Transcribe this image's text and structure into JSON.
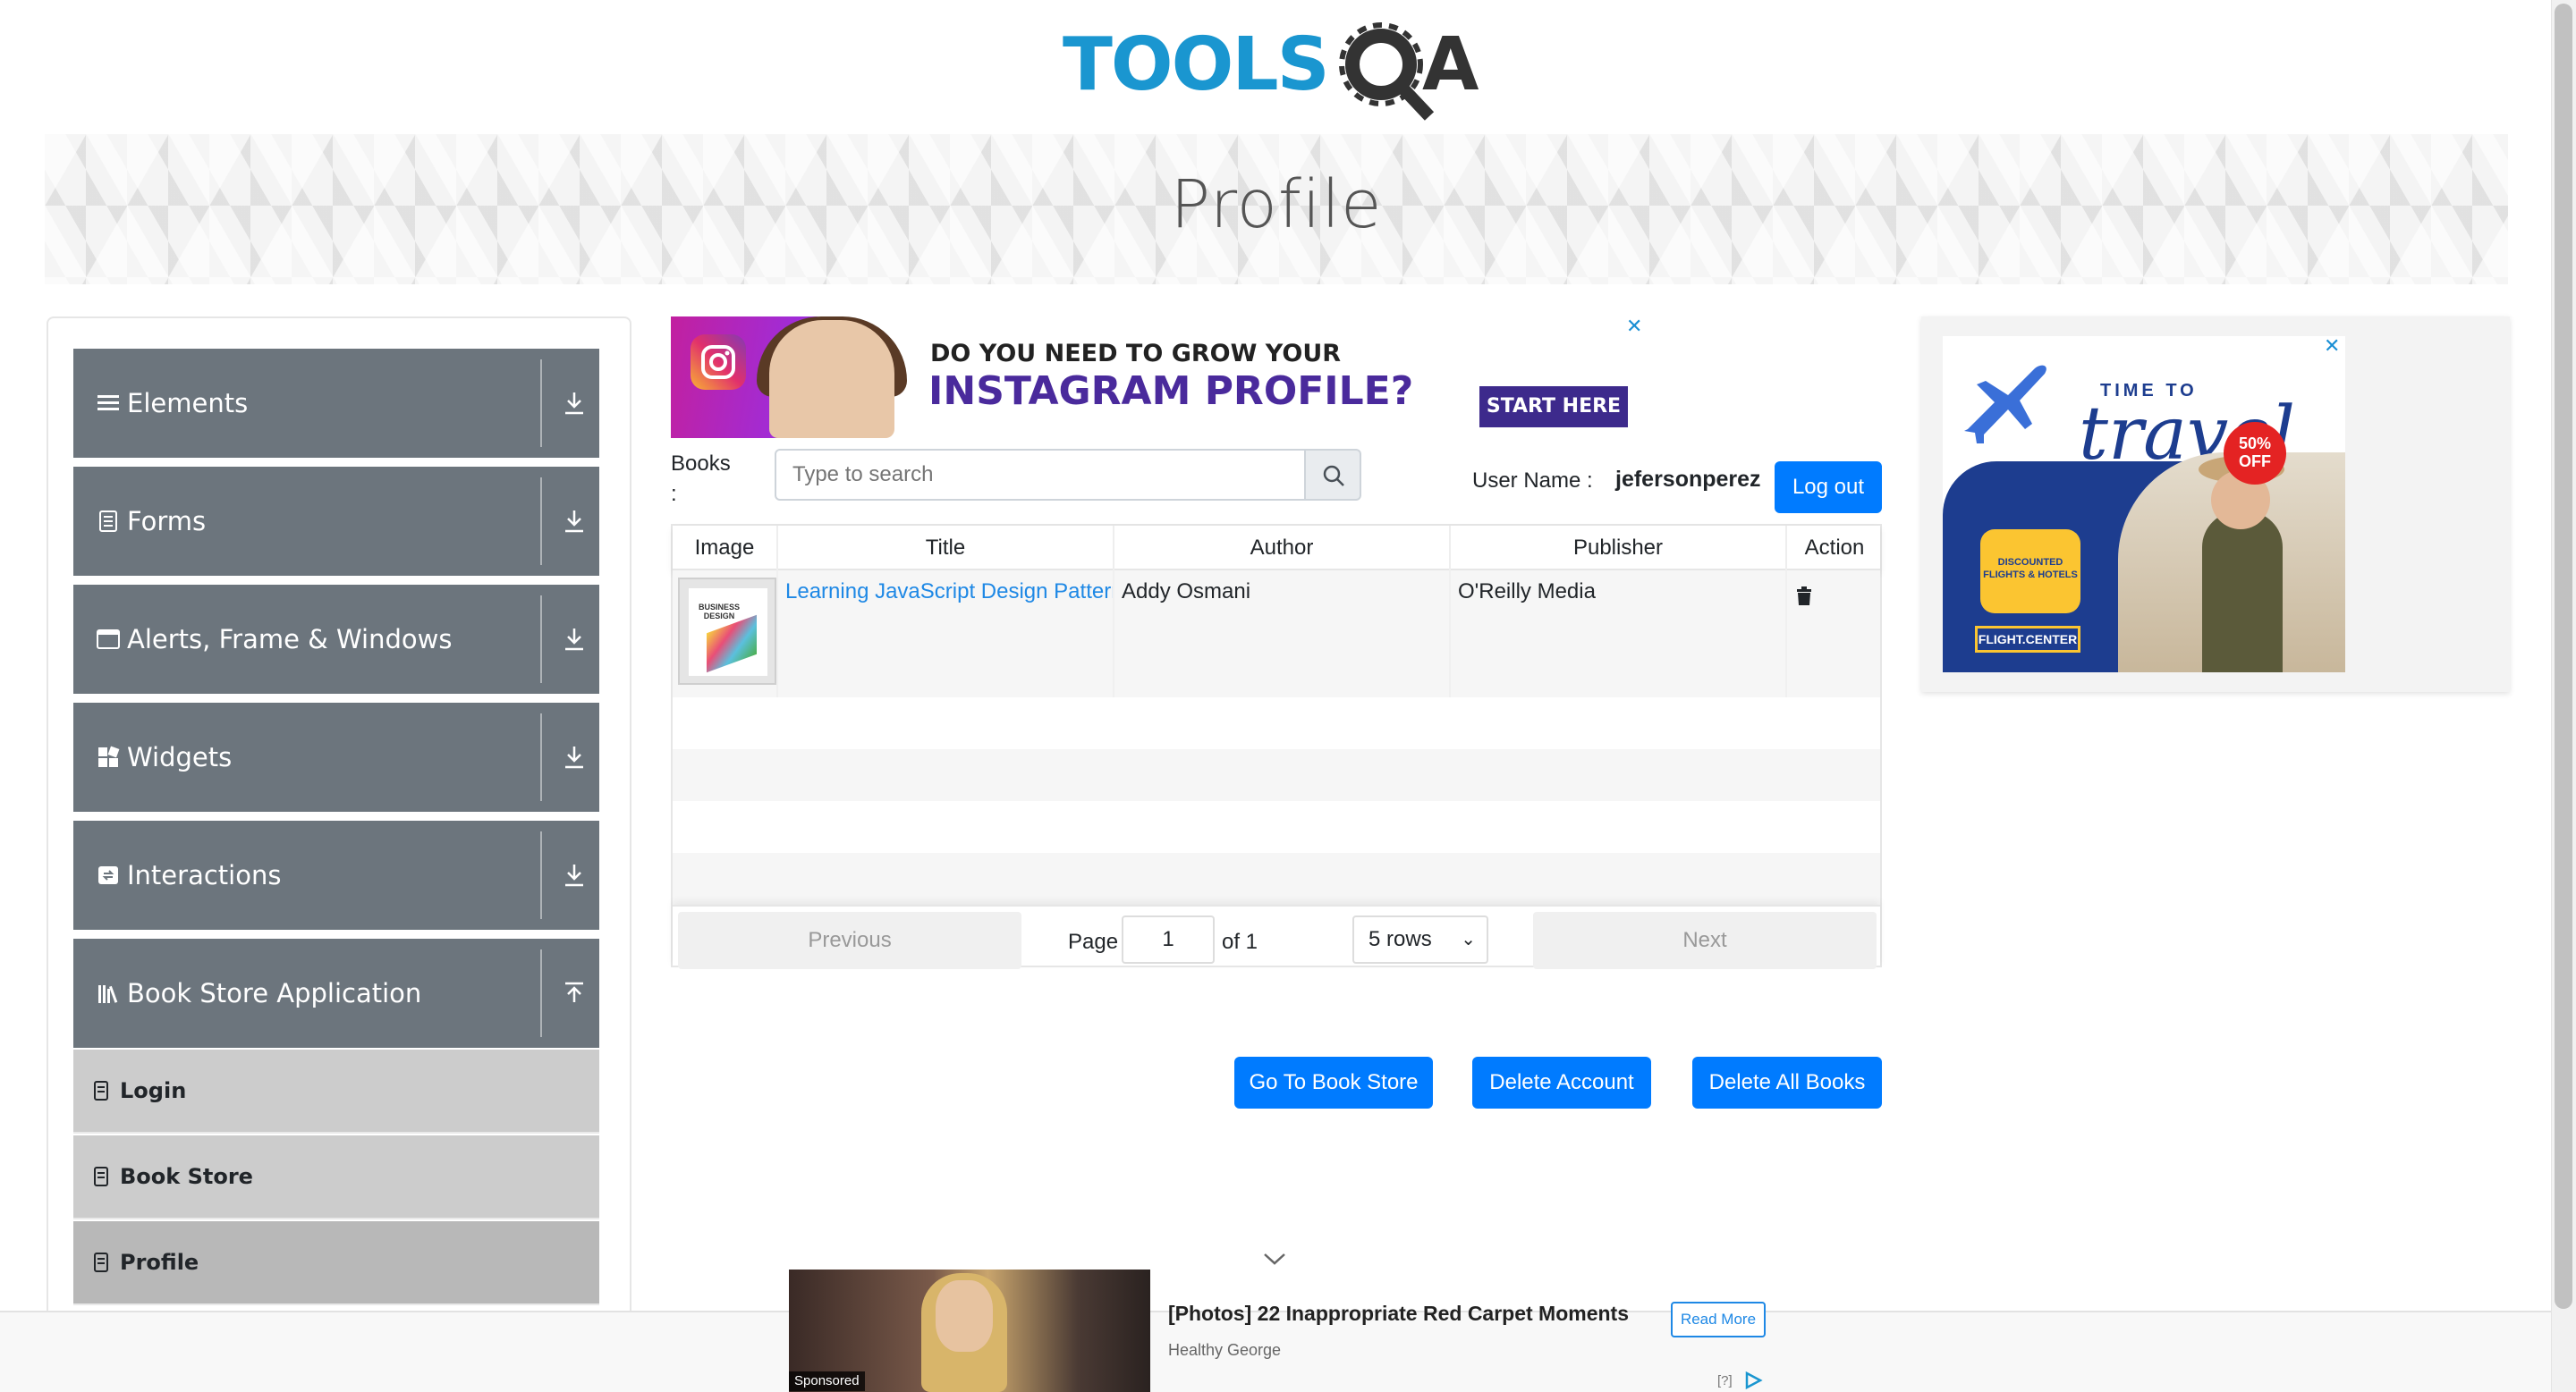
{
  "brand": {
    "logo_text": "TOOLSQA"
  },
  "banner": {
    "title": "Profile"
  },
  "sidebar": {
    "groups": [
      {
        "label": "Elements",
        "icon": "hamburger-icon"
      },
      {
        "label": "Forms",
        "icon": "form-icon"
      },
      {
        "label": "Alerts, Frame & Windows",
        "icon": "window-icon"
      },
      {
        "label": "Widgets",
        "icon": "widgets-icon"
      },
      {
        "label": "Interactions",
        "icon": "interactions-icon"
      },
      {
        "label": "Book Store Application",
        "icon": "library-icon"
      }
    ],
    "subitems": [
      {
        "label": "Login"
      },
      {
        "label": "Book Store"
      },
      {
        "label": "Profile"
      }
    ]
  },
  "top_ad": {
    "line1": "DO YOU NEED TO GROW YOUR",
    "line2": "INSTAGRAM PROFILE?",
    "cta": "START HERE",
    "close": "✕"
  },
  "search": {
    "label": "Books :",
    "placeholder": "Type to search"
  },
  "user": {
    "label": "User Name :",
    "value": "jefersonperez",
    "logout_label": "Log out"
  },
  "table": {
    "headers": [
      "Image",
      "Title",
      "Author",
      "Publisher",
      "Action"
    ],
    "rows": [
      {
        "image_text": "BUSINESS DESIGN",
        "title": "Learning JavaScript Design Patterns",
        "author": "Addy Osmani",
        "publisher": "O'Reilly Media"
      }
    ]
  },
  "pagination": {
    "previous": "Previous",
    "page_label": "Page",
    "page_value": "1",
    "of_label": "of 1",
    "rows_option": "5 rows",
    "next": "Next"
  },
  "actions": {
    "go_to_store": "Go To Book Store",
    "delete_account": "Delete Account",
    "delete_all": "Delete All Books"
  },
  "right_ad": {
    "line1": "TIME TO",
    "line2": "travel",
    "badge": "50% OFF",
    "bubble": "DISCOUNTED FLIGHTS & HOTELS",
    "brand": "FLIGHT.CENTER",
    "close": "✕"
  },
  "sponsored": {
    "tag": "Sponsored",
    "title": "[Photos] 22 Inappropriate Red Carpet Moments",
    "source": "Healthy George",
    "cta": "Read More",
    "adchoices": "[?]"
  },
  "colors": {
    "primary": "#007bff",
    "sidebar_group": "#6c757d",
    "sidebar_sub": "#cccccc",
    "link": "#1e88e5"
  }
}
